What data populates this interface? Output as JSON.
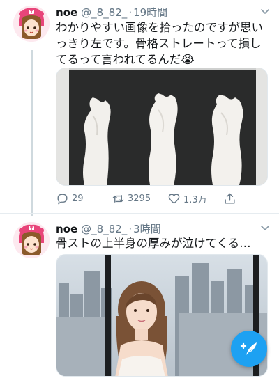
{
  "tweets": [
    {
      "name": "noe",
      "handle": "@_8_82_",
      "separator": "·",
      "time": "19時間",
      "text": "わかりやすい画像を拾ったのですが思いっきり左です。骨格ストレートって損してるって言われてるんだ😭",
      "media_icon": "torso-sculptures-photo",
      "stats": {
        "replies": "29",
        "retweets": "3295",
        "likes": "1.3万"
      }
    },
    {
      "name": "noe",
      "handle": "@_8_82_",
      "separator": "·",
      "time": "3時間",
      "text": "骨ストの上半身の厚みが泣けてくる…",
      "media_icon": "woman-city-window-photo"
    }
  ],
  "icons": {
    "avatar": "cartoon-girl-avatar-icon",
    "chevron": "chevron-down-icon",
    "reply": "reply-icon",
    "retweet": "retweet-icon",
    "like": "heart-icon",
    "share": "share-icon",
    "compose": "compose-tweet-icon"
  },
  "colors": {
    "accent": "#1da1f2",
    "secondary_text": "#657786",
    "divider": "#e6ecf0"
  }
}
